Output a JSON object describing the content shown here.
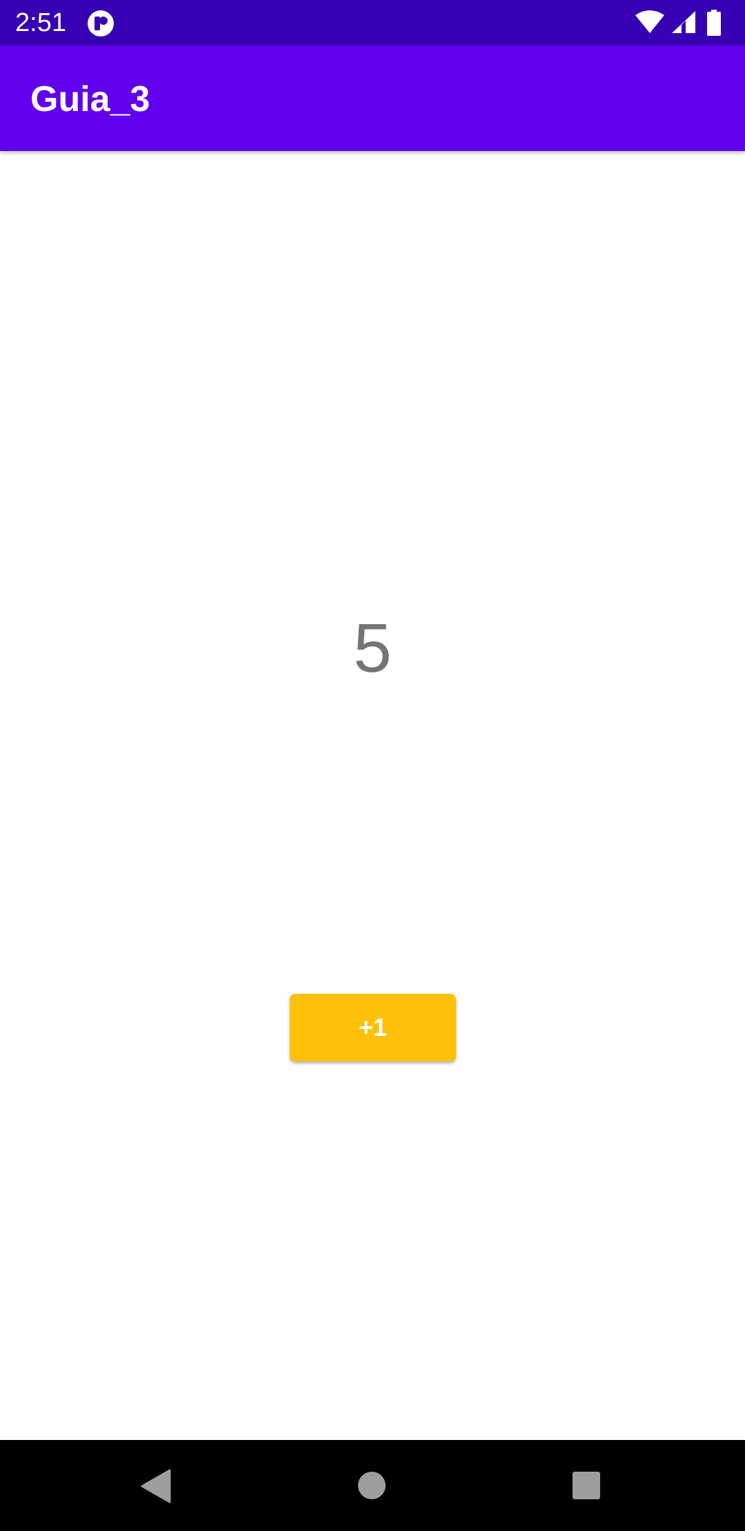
{
  "status_bar": {
    "time": "2:51",
    "background_color": "#3700b3",
    "icons": [
      "app-notification-icon",
      "wifi-icon",
      "cell-signal-icon",
      "battery-icon"
    ]
  },
  "app_bar": {
    "title": "Guia_3",
    "background_color": "#6200ee"
  },
  "main": {
    "counter_value": "5",
    "increment_button_label": "+1",
    "button_color": "#ffc107"
  },
  "nav_bar": {
    "icons": [
      "back-icon",
      "home-icon",
      "recents-icon"
    ]
  }
}
